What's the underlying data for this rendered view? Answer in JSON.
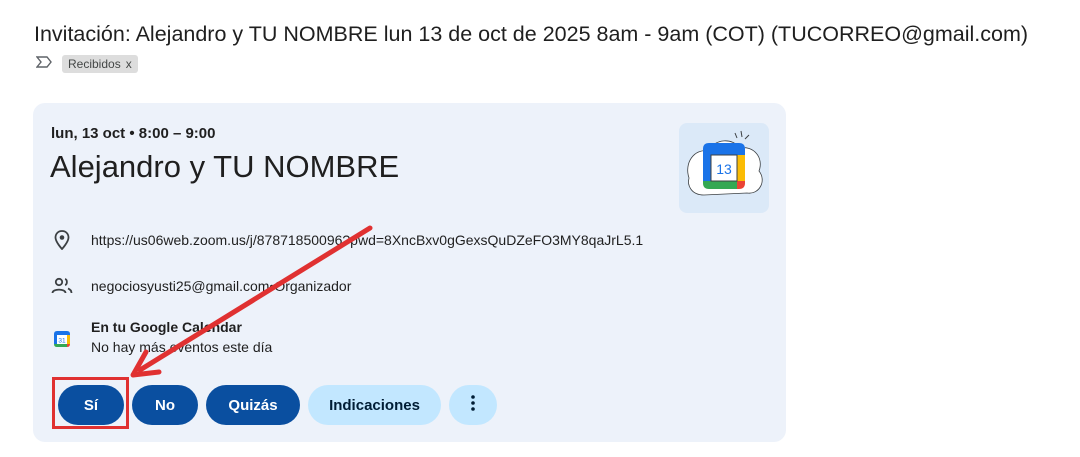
{
  "email": {
    "subject": "Invitación: Alejandro y TU NOMBRE lun 13 de oct de 2025 8am - 9am (COT) (TUCORREO@gmail.com)",
    "label": "Recibidos",
    "label_remove": "x"
  },
  "event": {
    "when": "lun, 13 oct • 8:00 – 9:00",
    "title": "Alejandro y TU NOMBRE",
    "calendar_day": "13",
    "location_url": "https://us06web.zoom.us/j/87871850096?pwd=8XncBxv0gGexsQuDZeFO3MY8qaJrL5.1",
    "organizer_email": "negociosyusti25@gmail.com",
    "organizer_separator": " • ",
    "organizer_role": "Organizador",
    "calendar_heading": "En tu Google Calendar",
    "calendar_sub": "No hay más eventos este día",
    "calendar_icon_day": "31"
  },
  "rsvp": {
    "yes": "Sí",
    "no": "No",
    "maybe": "Quizás",
    "directions": "Indicaciones"
  },
  "colors": {
    "primary": "#0b57d0",
    "tonal": "#c2e7ff",
    "card": "#edf2fa",
    "annotation": "#e03131"
  }
}
